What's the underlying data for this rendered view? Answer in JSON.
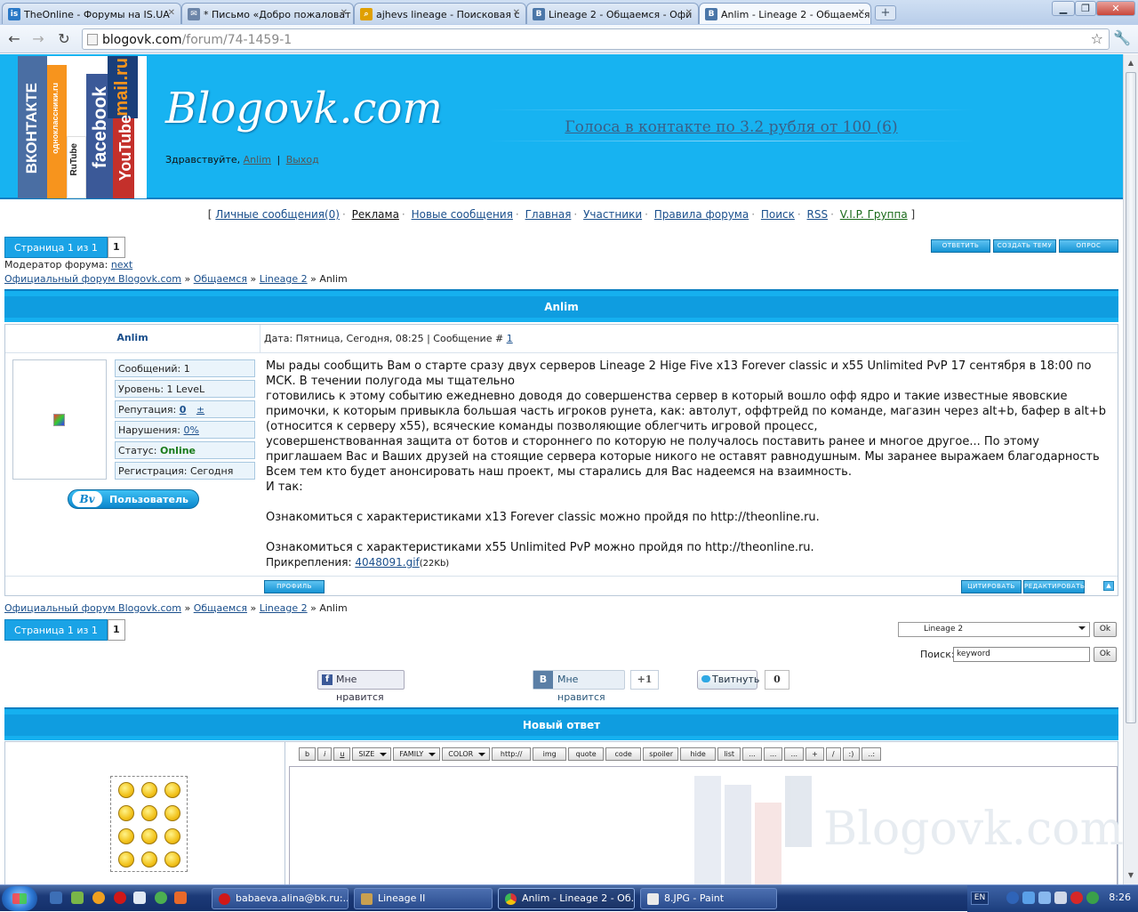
{
  "browser": {
    "tabs": [
      {
        "title": "TheOnline - Форумы на IS.UA",
        "favicon": "is",
        "color": "#2a79c7"
      },
      {
        "title": "* Письмо «Добро пожаловат",
        "favicon": "✉",
        "color": "#6c85a8"
      },
      {
        "title": "ajhevs lineage - Поисковая с",
        "favicon": "⌕",
        "color": "#e0a000"
      },
      {
        "title": "Lineage 2 - Общаемся - Офи",
        "favicon": "В",
        "color": "#4a76a8"
      },
      {
        "title": "Anlim - Lineage 2 - Общаемся",
        "favicon": "В",
        "color": "#4a76a8",
        "active": true
      }
    ],
    "new_tab": "+",
    "url_host": "blogovk.com",
    "url_path": "/forum/74-1459-1",
    "window_buttons": {
      "minimize": "▁",
      "maximize": "❐",
      "close": "✕"
    }
  },
  "header": {
    "site_title": "Blogovk.com",
    "logo_labels": [
      "ВКОНТАКТЕ",
      "одноклассники.ru",
      "RuTube",
      "facebook",
      "YouTube",
      "mail.ru"
    ],
    "greeting": "Здравствуйте,",
    "user_link": "Anlim",
    "separator": "|",
    "logout": "Выход",
    "banner": "Голоса в контакте по 3.2 рубля от 100 (6)"
  },
  "topnav": {
    "open": "[",
    "close": "]",
    "items": [
      "Личные сообщения(0)",
      "Реклама",
      "Новые сообщения",
      "Главная",
      "Участники",
      "Правила форума",
      "Поиск",
      "RSS",
      "V.I.P. Группа"
    ],
    "separator": "·"
  },
  "pager": {
    "label": "Страница 1 из 1",
    "page": "1"
  },
  "actions": {
    "reply": "ОТВЕТИТЬ",
    "new_topic": "СОЗДАТЬ ТЕМУ",
    "poll": "ОПРОС"
  },
  "moderator": {
    "label": "Модератор форума:",
    "name": "next"
  },
  "breadcrumb": {
    "sep": "»",
    "items": [
      "Официальный форум Blogovk.com",
      "Общаемся",
      "Lineage 2"
    ],
    "current": "Anlim"
  },
  "topic": {
    "title": "Anlim"
  },
  "post": {
    "author": "Anlim",
    "date_label": "Дата: Пятница, Сегодня, 08:25 | Сообщение #",
    "post_no": "1",
    "stats": [
      {
        "label": "Сообщений: 1"
      },
      {
        "label": "Уровень: 1 LeveL"
      },
      {
        "label": "Репутация: ",
        "link1": "0",
        "link2": "±"
      },
      {
        "label": "Нарушения: ",
        "link1": "0%"
      },
      {
        "label": "Статус: ",
        "bold": "Online"
      },
      {
        "label": "Регистрация: Сегодня"
      }
    ],
    "badge_logo": "Bv",
    "badge_text": "Пользователь",
    "text": [
      "Мы рады сообщить Вам о старте сразу двух серверов Lineage 2 Hige Five x13 Forever classic и x55 Unlimited PvP 17 сентября в 18:00 по МСК. В течении полугода мы тщательно",
      "готовились к этому событию ежедневно доводя до совершенства сервер в который вошло офф ядро и такие известные явовские примочки, к которым привыкла большая часть игроков рунета, как: автолут, оффтрейд по команде, магазин через alt+b, бафер в alt+b (относится к серверу x55), всяческие команды позволяющие облегчить игровой процесс,",
      "усовершенствованная защита от ботов и стороннего по которую не получалось поставить ранее и многое другое... По этому приглашаем Вас и Ваших друзей на стоящие сервера которые никого не оставят равнодушным. Мы заранее выражаем благодарность Всем тем кто будет анонсировать наш проект, мы старались для Вас надеемся на взаимность.",
      "И так:",
      "",
      "Ознакомиться с характеристиками x13 Forever classic можно пройдя по http://theonline.ru.",
      "",
      "Ознакомиться с характеристиками x55 Unlimited PvP можно пройдя по http://theonline.ru."
    ],
    "attach_label": "Прикрепления:",
    "attach_file": "4048091.gif",
    "attach_size": "(22Kb)",
    "profile_btn": "ПРОФИЛЬ",
    "quote_btn": "ЦИТИРОВАТЬ",
    "edit_btn": "РЕДАКТИРОВАТЬ",
    "top_btn": "▲"
  },
  "jump": {
    "selected": "Lineage 2",
    "ok": "Ok"
  },
  "search": {
    "label": "Поиск:",
    "value": "keyword",
    "ok": "Ok"
  },
  "social": {
    "fb_icon": "f",
    "fb_like": "Мне нравится",
    "vk_icon": "В",
    "vk_like": "Мне нравится",
    "vk_count": "+1",
    "tweet": "Твитнуть",
    "tweet_count": "0"
  },
  "reply": {
    "title": "Новый ответ",
    "toolbar": [
      "b",
      "i",
      "u",
      "SIZE",
      "FAMILY",
      "COLOR",
      "http://",
      "img",
      "quote",
      "code",
      "spoiler",
      "hide",
      "list",
      "...",
      "...",
      "...",
      "+",
      "/",
      ":)",
      "..:"
    ],
    "watermark": "Blogovk.com"
  },
  "taskbar": {
    "tasks": [
      "babaeva.alina@bk.ru:...",
      "Lineage II",
      "Anlim - Lineage 2 - Об...",
      "8.JPG - Paint"
    ],
    "lang": "EN",
    "clock": "8:26"
  }
}
